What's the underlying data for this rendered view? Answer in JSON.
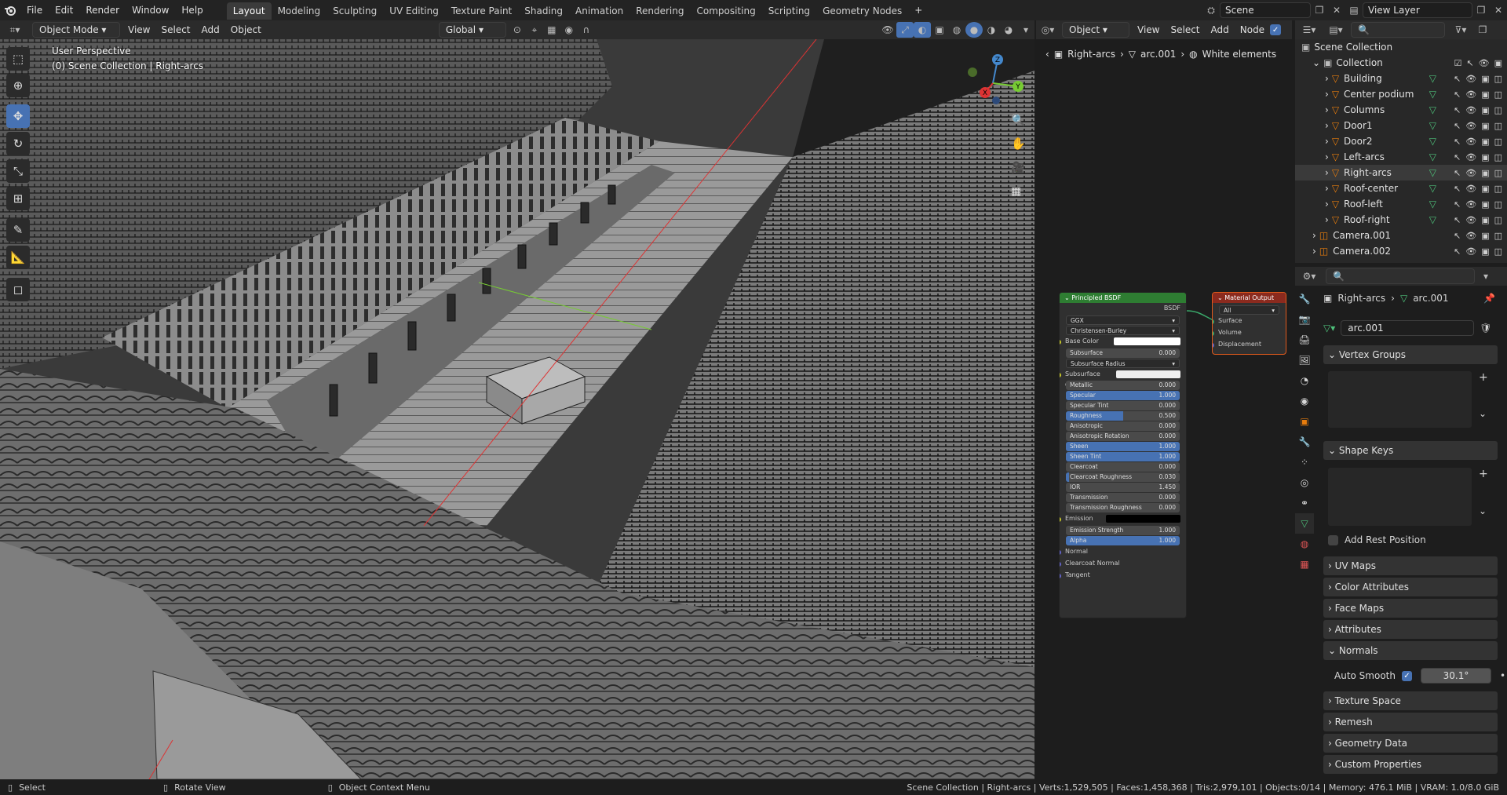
{
  "menu": {
    "items": [
      "File",
      "Edit",
      "Render",
      "Window",
      "Help"
    ]
  },
  "workspaces": [
    "Layout",
    "Modeling",
    "Sculpting",
    "UV Editing",
    "Texture Paint",
    "Shading",
    "Animation",
    "Rendering",
    "Compositing",
    "Scripting",
    "Geometry Nodes"
  ],
  "active_workspace": "Layout",
  "scene_name": "Scene",
  "view_layer": "View Layer",
  "viewport": {
    "mode": "Object Mode",
    "menus": [
      "View",
      "Select",
      "Add",
      "Object"
    ],
    "orientation": "Global",
    "info_line1": "User Perspective",
    "info_line2": "(0) Scene Collection | Right-arcs",
    "gizmo": {
      "z": "Z",
      "y": "Y",
      "x": "X"
    }
  },
  "node_editor": {
    "type": "Object",
    "menus": [
      "View",
      "Select",
      "Add",
      "Node"
    ],
    "breadcrumb": [
      "Right-arcs",
      "arc.001",
      "White elements"
    ],
    "bsdf": {
      "title": "Principled BSDF",
      "output": "BSDF",
      "distribution": "GGX",
      "subsurface_method": "Christensen-Burley",
      "base_color": "Base Color",
      "subsurface": {
        "label": "Subsurface",
        "value": "0.000"
      },
      "subsurface_radius": "Subsurface Radius",
      "subsurface_color": "Subsurface Color",
      "rows": [
        {
          "label": "Metallic",
          "value": "0.000",
          "fill": 0
        },
        {
          "label": "Specular",
          "value": "1.000",
          "fill": 1
        },
        {
          "label": "Specular Tint",
          "value": "0.000",
          "fill": 0
        },
        {
          "label": "Roughness",
          "value": "0.500",
          "fill": 0.5
        },
        {
          "label": "Anisotropic",
          "value": "0.000",
          "fill": 0
        },
        {
          "label": "Anisotropic Rotation",
          "value": "0.000",
          "fill": 0
        },
        {
          "label": "Sheen",
          "value": "1.000",
          "fill": 1
        },
        {
          "label": "Sheen Tint",
          "value": "1.000",
          "fill": 1
        },
        {
          "label": "Clearcoat",
          "value": "0.000",
          "fill": 0
        },
        {
          "label": "Clearcoat Roughness",
          "value": "0.030",
          "fill": 0.03
        },
        {
          "label": "IOR",
          "value": "1.450",
          "fill": 0
        },
        {
          "label": "Transmission",
          "value": "0.000",
          "fill": 0
        },
        {
          "label": "Transmission Roughness",
          "value": "0.000",
          "fill": 0
        }
      ],
      "emission": "Emission",
      "emission_strength": {
        "label": "Emission Strength",
        "value": "1.000"
      },
      "alpha": {
        "label": "Alpha",
        "value": "1.000"
      },
      "inputs": [
        "Normal",
        "Clearcoat Normal",
        "Tangent"
      ]
    },
    "output_node": {
      "title": "Material Output",
      "target": "All",
      "inputs": [
        "Surface",
        "Volume",
        "Displacement"
      ]
    }
  },
  "outliner": {
    "root": "Scene Collection",
    "collection": "Collection",
    "objects": [
      "Building",
      "Center podium",
      "Columns",
      "Door1",
      "Door2",
      "Left-arcs",
      "Right-arcs",
      "Roof-center",
      "Roof-left",
      "Roof-right"
    ],
    "selected": "Right-arcs",
    "cameras": [
      "Camera.001",
      "Camera.002"
    ]
  },
  "properties": {
    "breadcrumb": [
      "Right-arcs",
      "arc.001"
    ],
    "mesh_name": "arc.001",
    "panels": {
      "vertex_groups": "Vertex Groups",
      "shape_keys": "Shape Keys",
      "add_rest_position": "Add Rest Position",
      "uv_maps": "UV Maps",
      "color_attributes": "Color Attributes",
      "face_maps": "Face Maps",
      "attributes": "Attributes",
      "normals": "Normals",
      "auto_smooth": "Auto Smooth",
      "auto_smooth_angle": "30.1°",
      "texture_space": "Texture Space",
      "remesh": "Remesh",
      "geometry_data": "Geometry Data",
      "custom_properties": "Custom Properties"
    }
  },
  "statusbar": {
    "select": "Select",
    "rotate": "Rotate View",
    "context": "Object Context Menu",
    "stats": "Scene Collection | Right-arcs | Verts:1,529,505 | Faces:1,458,368 | Tris:2,979,101 | Objects:0/14 | Memory: 476.1 MiB | VRAM: 1.0/8.0 GiB"
  },
  "colors": {
    "accent": "#4772b3",
    "node_bsdf_header": "#2e7d32",
    "node_output_header": "#8b2a1e",
    "socket_yellow": "#c7c729",
    "socket_purple": "#6363c7",
    "axis_red": "#d33",
    "axis_green": "#7c3",
    "axis_blue": "#48c"
  }
}
